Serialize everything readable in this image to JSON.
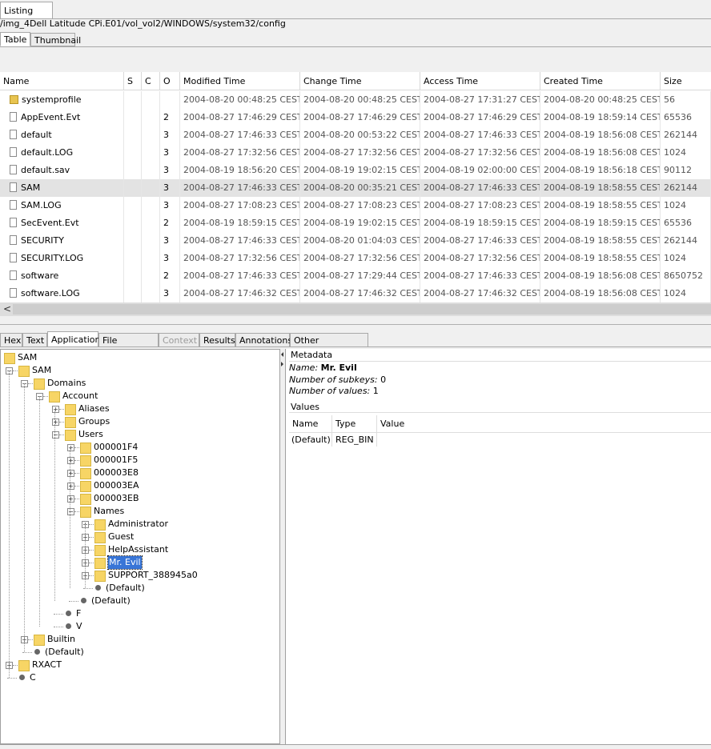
{
  "listing_tab": "Listing",
  "path": "/img_4Dell Latitude CPi.E01/vol_vol2/WINDOWS/system32/config",
  "view_tabs": [
    "Table",
    "Thumbnail"
  ],
  "columns": [
    "Name",
    "S",
    "C",
    "O",
    "Modified Time",
    "Change Time",
    "Access Time",
    "Created Time",
    "Size"
  ],
  "rows": [
    {
      "name": "systemprofile",
      "o": "",
      "mod": "2004-08-20 00:48:25 CEST",
      "chg": "2004-08-20 00:48:25 CEST",
      "acc": "2004-08-27 17:31:27 CEST",
      "cre": "2004-08-20 00:48:25 CEST",
      "size": "56",
      "icon": "folder-icon"
    },
    {
      "name": "AppEvent.Evt",
      "o": "2",
      "mod": "2004-08-27 17:46:29 CEST",
      "chg": "2004-08-27 17:46:29 CEST",
      "acc": "2004-08-27 17:46:29 CEST",
      "cre": "2004-08-19 18:59:14 CEST",
      "size": "65536",
      "icon": "file-icon"
    },
    {
      "name": "default",
      "o": "3",
      "mod": "2004-08-27 17:46:33 CEST",
      "chg": "2004-08-20 00:53:22 CEST",
      "acc": "2004-08-27 17:46:33 CEST",
      "cre": "2004-08-19 18:56:08 CEST",
      "size": "262144",
      "icon": "file-icon"
    },
    {
      "name": "default.LOG",
      "o": "3",
      "mod": "2004-08-27 17:32:56 CEST",
      "chg": "2004-08-27 17:32:56 CEST",
      "acc": "2004-08-27 17:32:56 CEST",
      "cre": "2004-08-19 18:56:08 CEST",
      "size": "1024",
      "icon": "file-icon"
    },
    {
      "name": "default.sav",
      "o": "3",
      "mod": "2004-08-19 18:56:20 CEST",
      "chg": "2004-08-19 19:02:15 CEST",
      "acc": "2004-08-19 02:00:00 CEST",
      "cre": "2004-08-19 18:56:18 CEST",
      "size": "90112",
      "icon": "file-icon"
    },
    {
      "name": "SAM",
      "o": "3",
      "mod": "2004-08-27 17:46:33 CEST",
      "chg": "2004-08-20 00:35:21 CEST",
      "acc": "2004-08-27 17:46:33 CEST",
      "cre": "2004-08-19 18:58:55 CEST",
      "size": "262144",
      "icon": "file-icon",
      "selected": true
    },
    {
      "name": "SAM.LOG",
      "o": "3",
      "mod": "2004-08-27 17:08:23 CEST",
      "chg": "2004-08-27 17:08:23 CEST",
      "acc": "2004-08-27 17:08:23 CEST",
      "cre": "2004-08-19 18:58:55 CEST",
      "size": "1024",
      "icon": "file-icon"
    },
    {
      "name": "SecEvent.Evt",
      "o": "2",
      "mod": "2004-08-19 18:59:15 CEST",
      "chg": "2004-08-19 19:02:15 CEST",
      "acc": "2004-08-19 18:59:15 CEST",
      "cre": "2004-08-19 18:59:15 CEST",
      "size": "65536",
      "icon": "file-icon"
    },
    {
      "name": "SECURITY",
      "o": "3",
      "mod": "2004-08-27 17:46:33 CEST",
      "chg": "2004-08-20 01:04:03 CEST",
      "acc": "2004-08-27 17:46:33 CEST",
      "cre": "2004-08-19 18:58:55 CEST",
      "size": "262144",
      "icon": "file-icon"
    },
    {
      "name": "SECURITY.LOG",
      "o": "3",
      "mod": "2004-08-27 17:32:56 CEST",
      "chg": "2004-08-27 17:32:56 CEST",
      "acc": "2004-08-27 17:32:56 CEST",
      "cre": "2004-08-19 18:58:55 CEST",
      "size": "1024",
      "icon": "file-icon"
    },
    {
      "name": "software",
      "o": "2",
      "mod": "2004-08-27 17:46:33 CEST",
      "chg": "2004-08-27 17:29:44 CEST",
      "acc": "2004-08-27 17:46:33 CEST",
      "cre": "2004-08-19 18:56:08 CEST",
      "size": "8650752",
      "icon": "file-icon"
    },
    {
      "name": "software.LOG",
      "o": "3",
      "mod": "2004-08-27 17:46:32 CEST",
      "chg": "2004-08-27 17:46:32 CEST",
      "acc": "2004-08-27 17:46:32 CEST",
      "cre": "2004-08-19 18:56:08 CEST",
      "size": "1024",
      "icon": "file-icon"
    }
  ],
  "scroll_left_glyph": "<",
  "content_tabs": [
    {
      "label": "Hex",
      "state": "normal"
    },
    {
      "label": "Text",
      "state": "normal"
    },
    {
      "label": "Application",
      "state": "selected"
    },
    {
      "label": "File Metadata",
      "state": "normal"
    },
    {
      "label": "Context",
      "state": "disabled"
    },
    {
      "label": "Results",
      "state": "normal"
    },
    {
      "label": "Annotations",
      "state": "normal"
    },
    {
      "label": "Other Occurrences",
      "state": "normal"
    }
  ],
  "tree": [
    {
      "label": "SAM",
      "depth": 0,
      "kind": "folder"
    },
    {
      "label": "SAM",
      "depth": 1,
      "kind": "folder",
      "exp": "−"
    },
    {
      "label": "Domains",
      "depth": 2,
      "kind": "folder",
      "exp": "−"
    },
    {
      "label": "Account",
      "depth": 3,
      "kind": "folder",
      "exp": "−"
    },
    {
      "label": "Aliases",
      "depth": 4,
      "kind": "folder",
      "exp": "+"
    },
    {
      "label": "Groups",
      "depth": 4,
      "kind": "folder",
      "exp": "+"
    },
    {
      "label": "Users",
      "depth": 4,
      "kind": "folder",
      "exp": "−"
    },
    {
      "label": "000001F4",
      "depth": 5,
      "kind": "folder",
      "exp": "+"
    },
    {
      "label": "000001F5",
      "depth": 5,
      "kind": "folder",
      "exp": "+"
    },
    {
      "label": "000003E8",
      "depth": 5,
      "kind": "folder",
      "exp": "+"
    },
    {
      "label": "000003EA",
      "depth": 5,
      "kind": "folder",
      "exp": "+"
    },
    {
      "label": "000003EB",
      "depth": 5,
      "kind": "folder",
      "exp": "+"
    },
    {
      "label": "Names",
      "depth": 5,
      "kind": "folder",
      "exp": "−"
    },
    {
      "label": "Administrator",
      "depth": 6,
      "kind": "folder",
      "exp": "+"
    },
    {
      "label": "Guest",
      "depth": 6,
      "kind": "folder",
      "exp": "+"
    },
    {
      "label": "HelpAssistant",
      "depth": 6,
      "kind": "folder",
      "exp": "+"
    },
    {
      "label": "Mr. Evil",
      "depth": 6,
      "kind": "folder",
      "exp": "+",
      "selected": true
    },
    {
      "label": "SUPPORT_388945a0",
      "depth": 6,
      "kind": "folder",
      "exp": "+"
    },
    {
      "label": "(Default)",
      "depth": 6,
      "kind": "value"
    },
    {
      "label": "(Default)",
      "depth": 5,
      "kind": "value"
    },
    {
      "label": "F",
      "depth": 4,
      "kind": "value"
    },
    {
      "label": "V",
      "depth": 4,
      "kind": "value"
    },
    {
      "label": "Builtin",
      "depth": 2,
      "kind": "folder",
      "exp": "+"
    },
    {
      "label": "(Default)",
      "depth": 2,
      "kind": "value"
    },
    {
      "label": "RXACT",
      "depth": 1,
      "kind": "folder",
      "exp": "+"
    },
    {
      "label": "C",
      "depth": 1,
      "kind": "value"
    }
  ],
  "metadata": {
    "title": "Metadata",
    "name_label": "Name:",
    "name_value": "Mr. Evil",
    "subkeys_label": "Number of subkeys:",
    "subkeys_value": "0",
    "values_label": "Number of values:",
    "values_value": "1"
  },
  "values": {
    "title": "Values",
    "columns": [
      "Name",
      "Type",
      "Value"
    ],
    "rows": [
      {
        "name": "(Default)",
        "type": "REG_BIN",
        "value": ""
      }
    ]
  }
}
